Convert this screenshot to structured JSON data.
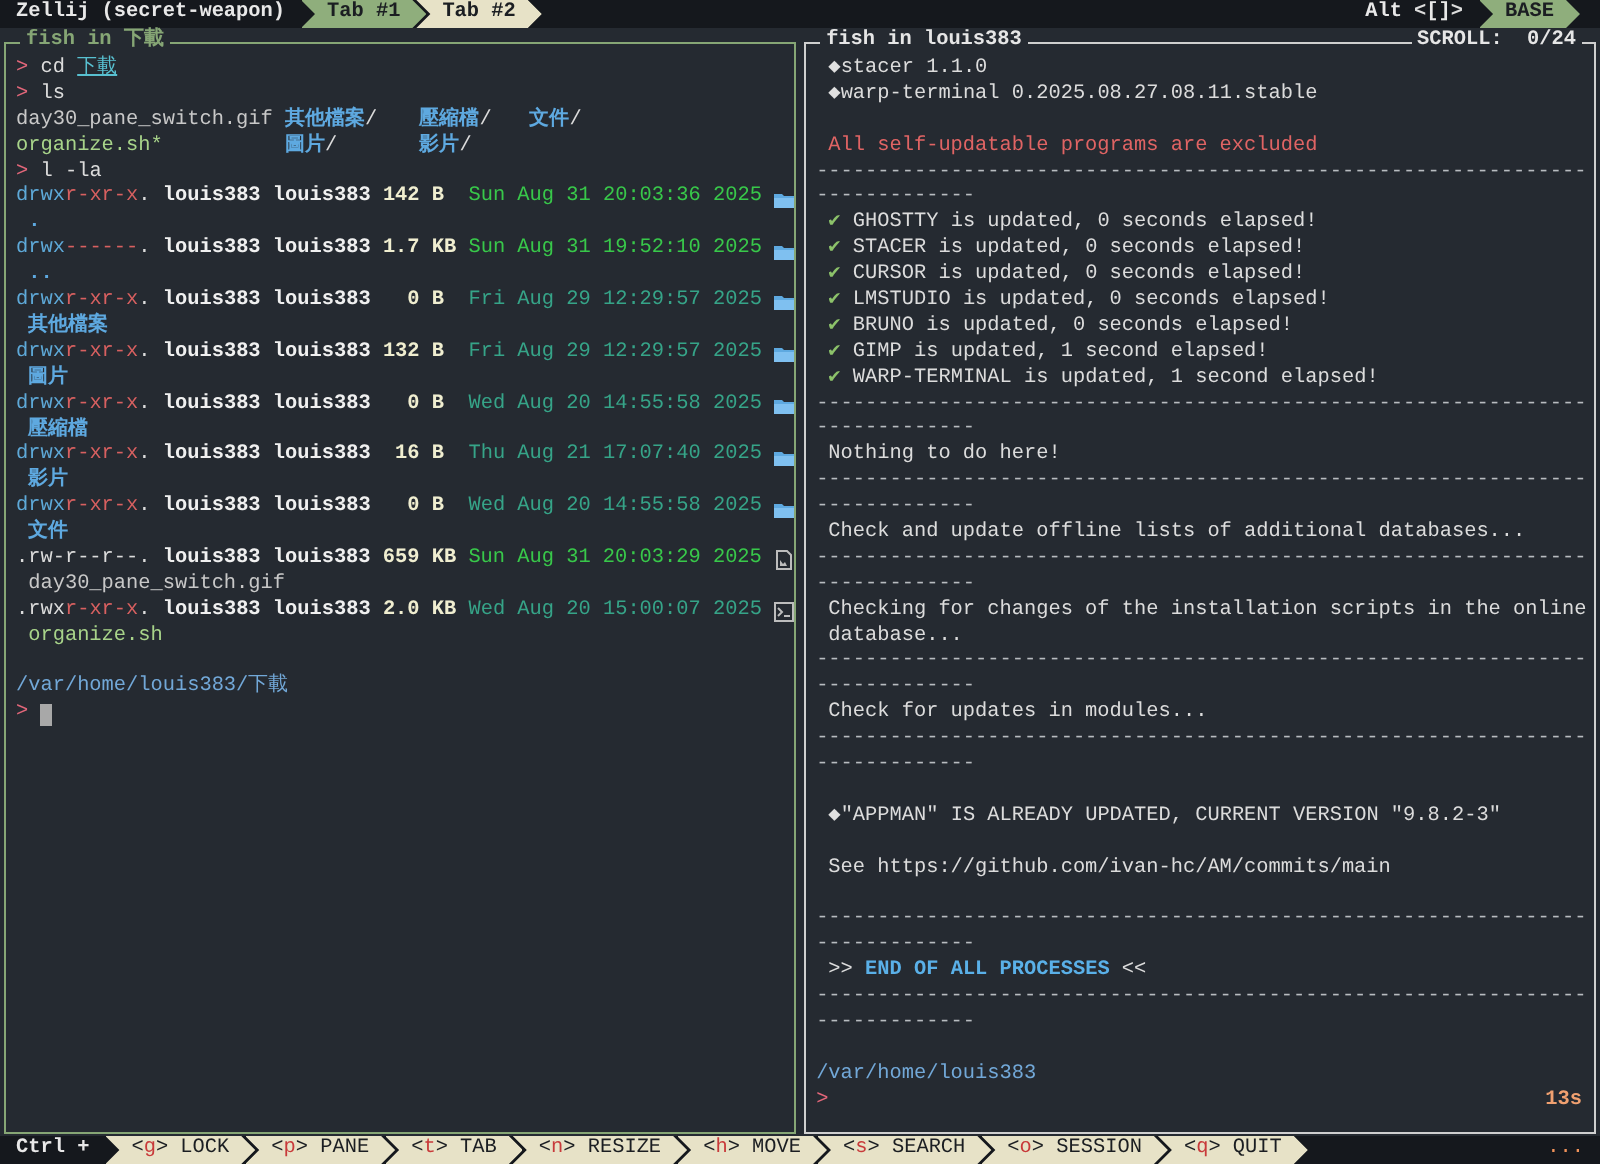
{
  "tab_bar": {
    "session": "Zellij (secret-weapon)",
    "tabs": [
      {
        "label": "Tab #1",
        "selected": true
      },
      {
        "label": "Tab #2",
        "selected": false
      }
    ],
    "mode_hint": [
      {
        "text": "Alt",
        "kind": "mod"
      },
      {
        "text": " <",
        "kind": "plain"
      },
      {
        "text": "[]",
        "kind": "mod"
      },
      {
        "text": ">",
        "kind": "plain"
      }
    ],
    "mode": "BASE"
  },
  "panes": [
    {
      "title": "fish in 下載",
      "focused": true,
      "lines": [
        {
          "kind": "text",
          "segments": [
            {
              "text": ">",
              "kind": "prompt"
            },
            {
              "text": " cd ",
              "kind": "cmd"
            },
            {
              "text": "下載",
              "kind": "link"
            }
          ]
        },
        {
          "kind": "text",
          "segments": [
            {
              "text": ">",
              "kind": "prompt"
            },
            {
              "text": " ls",
              "kind": "cmd"
            }
          ]
        },
        {
          "kind": "grid",
          "items": [
            {
              "text": "day30_pane_switch.gif",
              "kind": "file"
            },
            {
              "text": "其他檔案",
              "kind": "dir",
              "suffix": "/"
            },
            {
              "text": "壓縮檔",
              "kind": "dir",
              "suffix": "/"
            },
            {
              "text": "文件",
              "kind": "dir",
              "suffix": "/"
            },
            {
              "text": "organize.sh*",
              "kind": "exe"
            },
            {
              "text": "圖片",
              "kind": "dir",
              "suffix": "/"
            },
            {
              "text": "影片",
              "kind": "dir",
              "suffix": "/"
            }
          ]
        },
        {
          "kind": "text",
          "segments": [
            {
              "text": ">",
              "kind": "prompt"
            },
            {
              "text": " l -la",
              "kind": "cmd"
            }
          ]
        },
        {
          "kind": "dir-entry",
          "perms": [
            {
              "text": "drwx",
              "kind": "pa"
            },
            {
              "text": "r-xr-x",
              "kind": "pb"
            },
            {
              "text": ".",
              "kind": "pc"
            }
          ],
          "owner": "louis383 louis383",
          "size": "142 B",
          "date": "Sun Aug 31 20:03:36 2025",
          "recent": true
        },
        {
          "kind": "text",
          "segments": [
            {
              "text": " .",
              "kind": "dir"
            }
          ]
        },
        {
          "kind": "dir-entry",
          "perms": [
            {
              "text": "drwx",
              "kind": "pa"
            },
            {
              "text": "------",
              "kind": "pb"
            },
            {
              "text": ".",
              "kind": "pc"
            }
          ],
          "owner": "louis383 louis383",
          "size": "1.7 KB",
          "date": "Sun Aug 31 19:52:10 2025",
          "recent": true
        },
        {
          "kind": "text",
          "segments": [
            {
              "text": " ..",
              "kind": "dir"
            }
          ]
        },
        {
          "kind": "dir-entry",
          "perms": [
            {
              "text": "drwx",
              "kind": "pa"
            },
            {
              "text": "r-xr-x",
              "kind": "pb"
            },
            {
              "text": ".",
              "kind": "pc"
            }
          ],
          "owner": "louis383 louis383",
          "size": "  0 B",
          "date": "Fri Aug 29 12:29:57 2025",
          "recent": false
        },
        {
          "kind": "text",
          "segments": [
            {
              "text": " 其他檔案",
              "kind": "dir"
            }
          ]
        },
        {
          "kind": "dir-entry",
          "perms": [
            {
              "text": "drwx",
              "kind": "pa"
            },
            {
              "text": "r-xr-x",
              "kind": "pb"
            },
            {
              "text": ".",
              "kind": "pc"
            }
          ],
          "owner": "louis383 louis383",
          "size": "132 B",
          "date": "Fri Aug 29 12:29:57 2025",
          "recent": false
        },
        {
          "kind": "text",
          "segments": [
            {
              "text": " 圖片",
              "kind": "dir"
            }
          ]
        },
        {
          "kind": "dir-entry",
          "perms": [
            {
              "text": "drwx",
              "kind": "pa"
            },
            {
              "text": "r-xr-x",
              "kind": "pb"
            },
            {
              "text": ".",
              "kind": "pc"
            }
          ],
          "owner": "louis383 louis383",
          "size": "  0 B",
          "date": "Wed Aug 20 14:55:58 2025",
          "recent": false
        },
        {
          "kind": "text",
          "segments": [
            {
              "text": " 壓縮檔",
              "kind": "dir"
            }
          ]
        },
        {
          "kind": "dir-entry",
          "perms": [
            {
              "text": "drwx",
              "kind": "pa"
            },
            {
              "text": "r-xr-x",
              "kind": "pb"
            },
            {
              "text": ".",
              "kind": "pc"
            }
          ],
          "owner": "louis383 louis383",
          "size": " 16 B",
          "date": "Thu Aug 21 17:07:40 2025",
          "recent": false
        },
        {
          "kind": "text",
          "segments": [
            {
              "text": " 影片",
              "kind": "dir"
            }
          ]
        },
        {
          "kind": "dir-entry",
          "perms": [
            {
              "text": "drwx",
              "kind": "pa"
            },
            {
              "text": "r-xr-x",
              "kind": "pb"
            },
            {
              "text": ".",
              "kind": "pc"
            }
          ],
          "owner": "louis383 louis383",
          "size": "  0 B",
          "date": "Wed Aug 20 14:55:58 2025",
          "recent": false
        },
        {
          "kind": "text",
          "segments": [
            {
              "text": " 文件",
              "kind": "dir"
            }
          ]
        },
        {
          "kind": "image-entry",
          "perms": [
            {
              "text": ".rw-r--r--.",
              "kind": "pc"
            }
          ],
          "owner": "louis383 louis383",
          "size": "659 KB",
          "date": "Sun Aug 31 20:03:29 2025",
          "recent": true
        },
        {
          "kind": "text",
          "segments": [
            {
              "text": " day30_pane_switch.gif",
              "kind": "file"
            }
          ]
        },
        {
          "kind": "script-entry",
          "perms": [
            {
              "text": ".rwx",
              "kind": "pc"
            },
            {
              "text": "r-xr-x",
              "kind": "pb"
            },
            {
              "text": ".",
              "kind": "pc"
            }
          ],
          "owner": "louis383 louis383",
          "size": "2.0 KB",
          "date": "Wed Aug 20 15:00:07 2025",
          "recent": false
        },
        {
          "kind": "text",
          "segments": [
            {
              "text": " organize.sh",
              "kind": "exe"
            }
          ]
        },
        {
          "kind": "blank"
        },
        {
          "kind": "text",
          "segments": [
            {
              "text": "/var/home/louis383/下載",
              "kind": "path"
            }
          ]
        },
        {
          "kind": "text",
          "cursor": true,
          "segments": [
            {
              "text": ">",
              "kind": "prompt"
            }
          ]
        }
      ]
    },
    {
      "title": "fish in louis383",
      "scroll": "SCROLL:  0/24",
      "focused": false,
      "lines": [
        {
          "kind": "text",
          "segments": [
            {
              "text": " ◆",
              "kind": "diamond"
            },
            {
              "text": "stacer 1.1.0",
              "kind": "out"
            }
          ]
        },
        {
          "kind": "text",
          "segments": [
            {
              "text": " ◆",
              "kind": "diamond"
            },
            {
              "text": "warp-terminal 0.2025.08.27.08.11.stable",
              "kind": "out"
            }
          ]
        },
        {
          "kind": "blank"
        },
        {
          "kind": "text",
          "segments": [
            {
              "text": " All self-updatable programs are excluded",
              "kind": "error"
            }
          ]
        },
        {
          "kind": "text",
          "segments": [
            {
              "text": "---------------------------------------------------------------",
              "kind": "dash"
            }
          ]
        },
        {
          "kind": "text",
          "segments": [
            {
              "text": "-------------",
              "kind": "dash"
            }
          ]
        },
        {
          "kind": "text",
          "segments": [
            {
              "text": " ✔",
              "kind": "check"
            },
            {
              "text": " GHOSTTY is updated, 0 seconds elapsed!",
              "kind": "out"
            }
          ]
        },
        {
          "kind": "text",
          "segments": [
            {
              "text": " ✔",
              "kind": "check"
            },
            {
              "text": " STACER is updated, 0 seconds elapsed!",
              "kind": "out"
            }
          ]
        },
        {
          "kind": "text",
          "segments": [
            {
              "text": " ✔",
              "kind": "check"
            },
            {
              "text": " CURSOR is updated, 0 seconds elapsed!",
              "kind": "out"
            }
          ]
        },
        {
          "kind": "text",
          "segments": [
            {
              "text": " ✔",
              "kind": "check"
            },
            {
              "text": " LMSTUDIO is updated, 0 seconds elapsed!",
              "kind": "out"
            }
          ]
        },
        {
          "kind": "text",
          "segments": [
            {
              "text": " ✔",
              "kind": "check"
            },
            {
              "text": " BRUNO is updated, 0 seconds elapsed!",
              "kind": "out"
            }
          ]
        },
        {
          "kind": "text",
          "segments": [
            {
              "text": " ✔",
              "kind": "check"
            },
            {
              "text": " GIMP is updated, 1 second elapsed!",
              "kind": "out"
            }
          ]
        },
        {
          "kind": "text",
          "segments": [
            {
              "text": " ✔",
              "kind": "check"
            },
            {
              "text": " WARP-TERMINAL is updated, 1 second elapsed!",
              "kind": "out"
            }
          ]
        },
        {
          "kind": "text",
          "segments": [
            {
              "text": "---------------------------------------------------------------",
              "kind": "dash"
            }
          ]
        },
        {
          "kind": "text",
          "segments": [
            {
              "text": "-------------",
              "kind": "dash"
            }
          ]
        },
        {
          "kind": "text",
          "segments": [
            {
              "text": " Nothing to do here!",
              "kind": "out"
            }
          ]
        },
        {
          "kind": "text",
          "segments": [
            {
              "text": "---------------------------------------------------------------",
              "kind": "dash"
            }
          ]
        },
        {
          "kind": "text",
          "segments": [
            {
              "text": "-------------",
              "kind": "dash"
            }
          ]
        },
        {
          "kind": "text",
          "segments": [
            {
              "text": " Check and update offline lists of additional databases...",
              "kind": "out"
            }
          ]
        },
        {
          "kind": "text",
          "segments": [
            {
              "text": "---------------------------------------------------------------",
              "kind": "dash"
            }
          ]
        },
        {
          "kind": "text",
          "segments": [
            {
              "text": "-------------",
              "kind": "dash"
            }
          ]
        },
        {
          "kind": "text",
          "segments": [
            {
              "text": " Checking for changes of the installation scripts in the online",
              "kind": "out"
            }
          ]
        },
        {
          "kind": "text",
          "segments": [
            {
              "text": " database...",
              "kind": "out"
            }
          ]
        },
        {
          "kind": "text",
          "segments": [
            {
              "text": "---------------------------------------------------------------",
              "kind": "dash"
            }
          ]
        },
        {
          "kind": "text",
          "segments": [
            {
              "text": "-------------",
              "kind": "dash"
            }
          ]
        },
        {
          "kind": "text",
          "segments": [
            {
              "text": " Check for updates in modules...",
              "kind": "out"
            }
          ]
        },
        {
          "kind": "text",
          "segments": [
            {
              "text": "---------------------------------------------------------------",
              "kind": "dash"
            }
          ]
        },
        {
          "kind": "text",
          "segments": [
            {
              "text": "-------------",
              "kind": "dash"
            }
          ]
        },
        {
          "kind": "blank"
        },
        {
          "kind": "text",
          "segments": [
            {
              "text": " ◆",
              "kind": "diamond"
            },
            {
              "text": "\"APPMAN\" IS ALREADY UPDATED, CURRENT VERSION \"9.8.2-3\"",
              "kind": "out"
            }
          ]
        },
        {
          "kind": "blank"
        },
        {
          "kind": "text",
          "segments": [
            {
              "text": " See https://github.com/ivan-hc/AM/commits/main",
              "kind": "out"
            }
          ]
        },
        {
          "kind": "blank"
        },
        {
          "kind": "text",
          "segments": [
            {
              "text": "---------------------------------------------------------------",
              "kind": "dash"
            }
          ]
        },
        {
          "kind": "text",
          "segments": [
            {
              "text": "-------------",
              "kind": "dash"
            }
          ]
        },
        {
          "kind": "text",
          "segments": [
            {
              "text": " >> ",
              "kind": "out"
            },
            {
              "text": "END OF ALL PROCESSES",
              "kind": "heading"
            },
            {
              "text": " <<",
              "kind": "out"
            }
          ]
        },
        {
          "kind": "text",
          "segments": [
            {
              "text": "---------------------------------------------------------------",
              "kind": "dash"
            }
          ]
        },
        {
          "kind": "text",
          "segments": [
            {
              "text": "-------------",
              "kind": "dash"
            }
          ]
        },
        {
          "kind": "blank"
        },
        {
          "kind": "text",
          "segments": [
            {
              "text": "/var/home/louis383",
              "kind": "path"
            }
          ]
        },
        {
          "kind": "text",
          "segments": [
            {
              "text": ">",
              "kind": "prompt"
            },
            {
              "text": "13s",
              "kind": "note"
            }
          ]
        }
      ]
    }
  ],
  "status_bar": {
    "prefix": "Ctrl +",
    "keys": [
      {
        "segments": [
          {
            "text": "<",
            "kind": "plain"
          },
          {
            "text": "g",
            "kind": "key"
          },
          {
            "text": "> LOCK",
            "kind": "plain"
          }
        ]
      },
      {
        "segments": [
          {
            "text": "<",
            "kind": "plain"
          },
          {
            "text": "p",
            "kind": "key"
          },
          {
            "text": "> PANE",
            "kind": "plain"
          }
        ]
      },
      {
        "segments": [
          {
            "text": "<",
            "kind": "plain"
          },
          {
            "text": "t",
            "kind": "key"
          },
          {
            "text": "> TAB",
            "kind": "plain"
          }
        ]
      },
      {
        "segments": [
          {
            "text": "<",
            "kind": "plain"
          },
          {
            "text": "n",
            "kind": "key"
          },
          {
            "text": "> RESIZE",
            "kind": "plain"
          }
        ]
      },
      {
        "segments": [
          {
            "text": "<",
            "kind": "plain"
          },
          {
            "text": "h",
            "kind": "key"
          },
          {
            "text": "> MOVE",
            "kind": "plain"
          }
        ]
      },
      {
        "segments": [
          {
            "text": "<",
            "kind": "plain"
          },
          {
            "text": "s",
            "kind": "key"
          },
          {
            "text": "> SEARCH",
            "kind": "plain"
          }
        ]
      },
      {
        "segments": [
          {
            "text": "<",
            "kind": "plain"
          },
          {
            "text": "o",
            "kind": "key"
          },
          {
            "text": "> SESSION",
            "kind": "plain"
          }
        ]
      },
      {
        "segments": [
          {
            "text": "<",
            "kind": "plain"
          },
          {
            "text": "q",
            "kind": "key"
          },
          {
            "text": "> QUIT",
            "kind": "plain"
          }
        ]
      }
    ],
    "more": "..."
  }
}
